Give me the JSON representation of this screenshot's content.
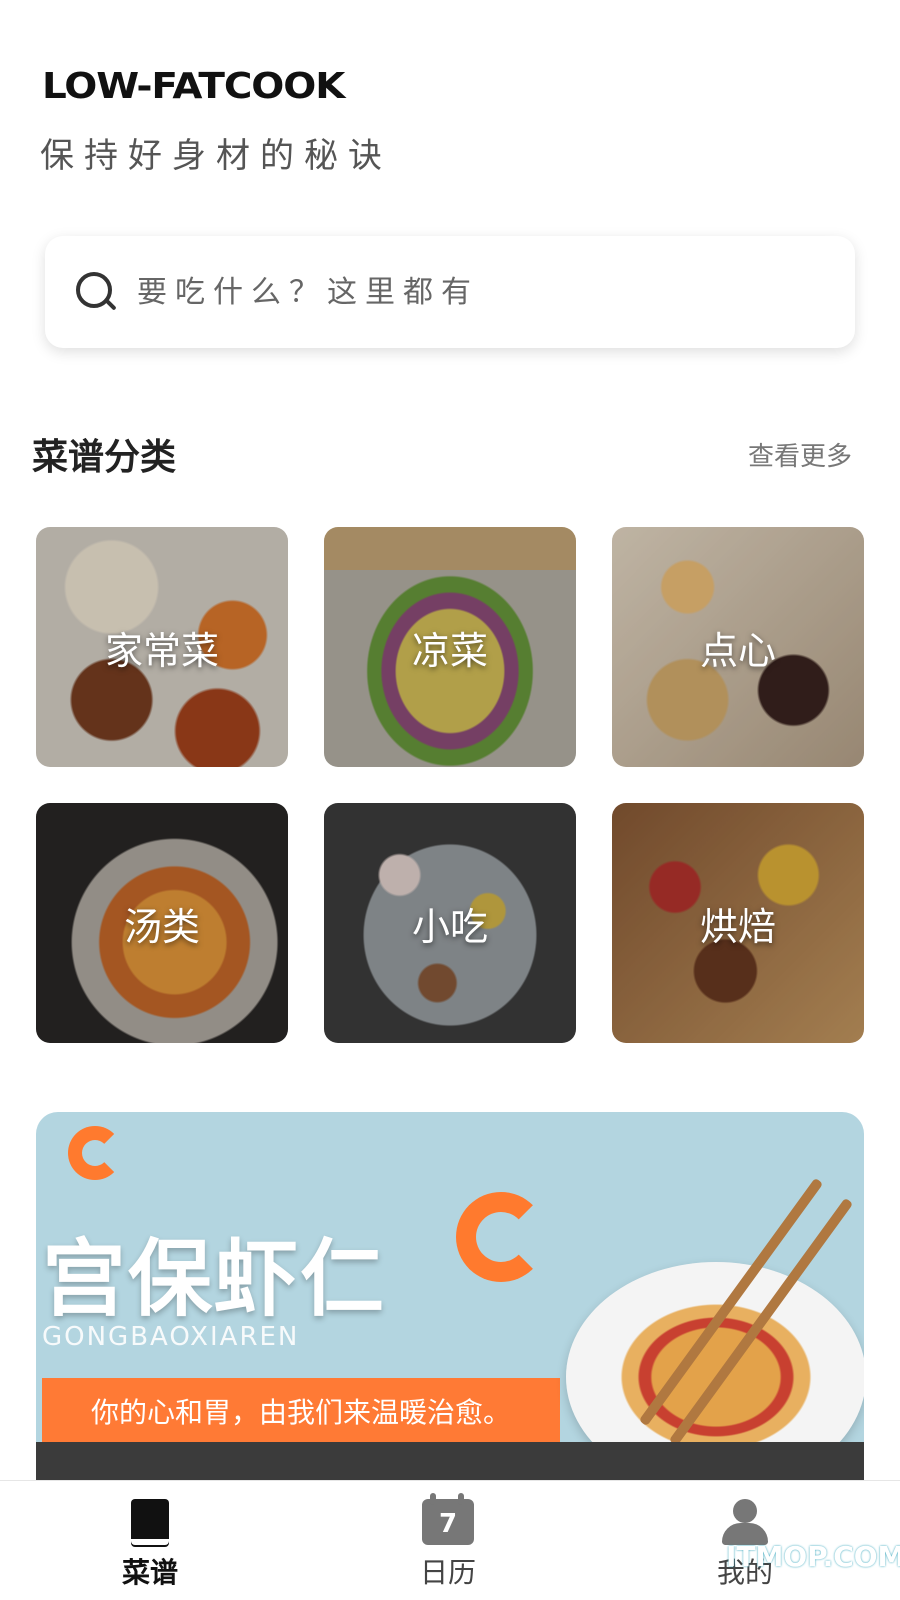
{
  "header": {
    "brand": "LOW-FATCOOK",
    "tagline": "保持好身材的秘诀"
  },
  "search": {
    "placeholder": "要吃什么？这里都有",
    "icon": "search-icon"
  },
  "categories": {
    "title": "菜谱分类",
    "more_label": "查看更多",
    "items": [
      {
        "label": "家常菜"
      },
      {
        "label": "凉菜"
      },
      {
        "label": "点心"
      },
      {
        "label": "汤类"
      },
      {
        "label": "小吃"
      },
      {
        "label": "烘焙"
      }
    ]
  },
  "banner": {
    "title": "宫保虾仁",
    "subtitle": "GONGBAOXIAREN",
    "slogan": "你的心和胃，由我们来温暖治愈。",
    "accent_color": "#ff7a35",
    "background_color": "#b3d5e0"
  },
  "tabbar": {
    "items": [
      {
        "label": "菜谱",
        "icon": "book-icon",
        "active": true
      },
      {
        "label": "日历",
        "icon": "calendar-icon",
        "day": "7",
        "active": false
      },
      {
        "label": "我的",
        "icon": "user-icon",
        "active": false
      }
    ]
  },
  "watermark": "ITMOP.COM"
}
